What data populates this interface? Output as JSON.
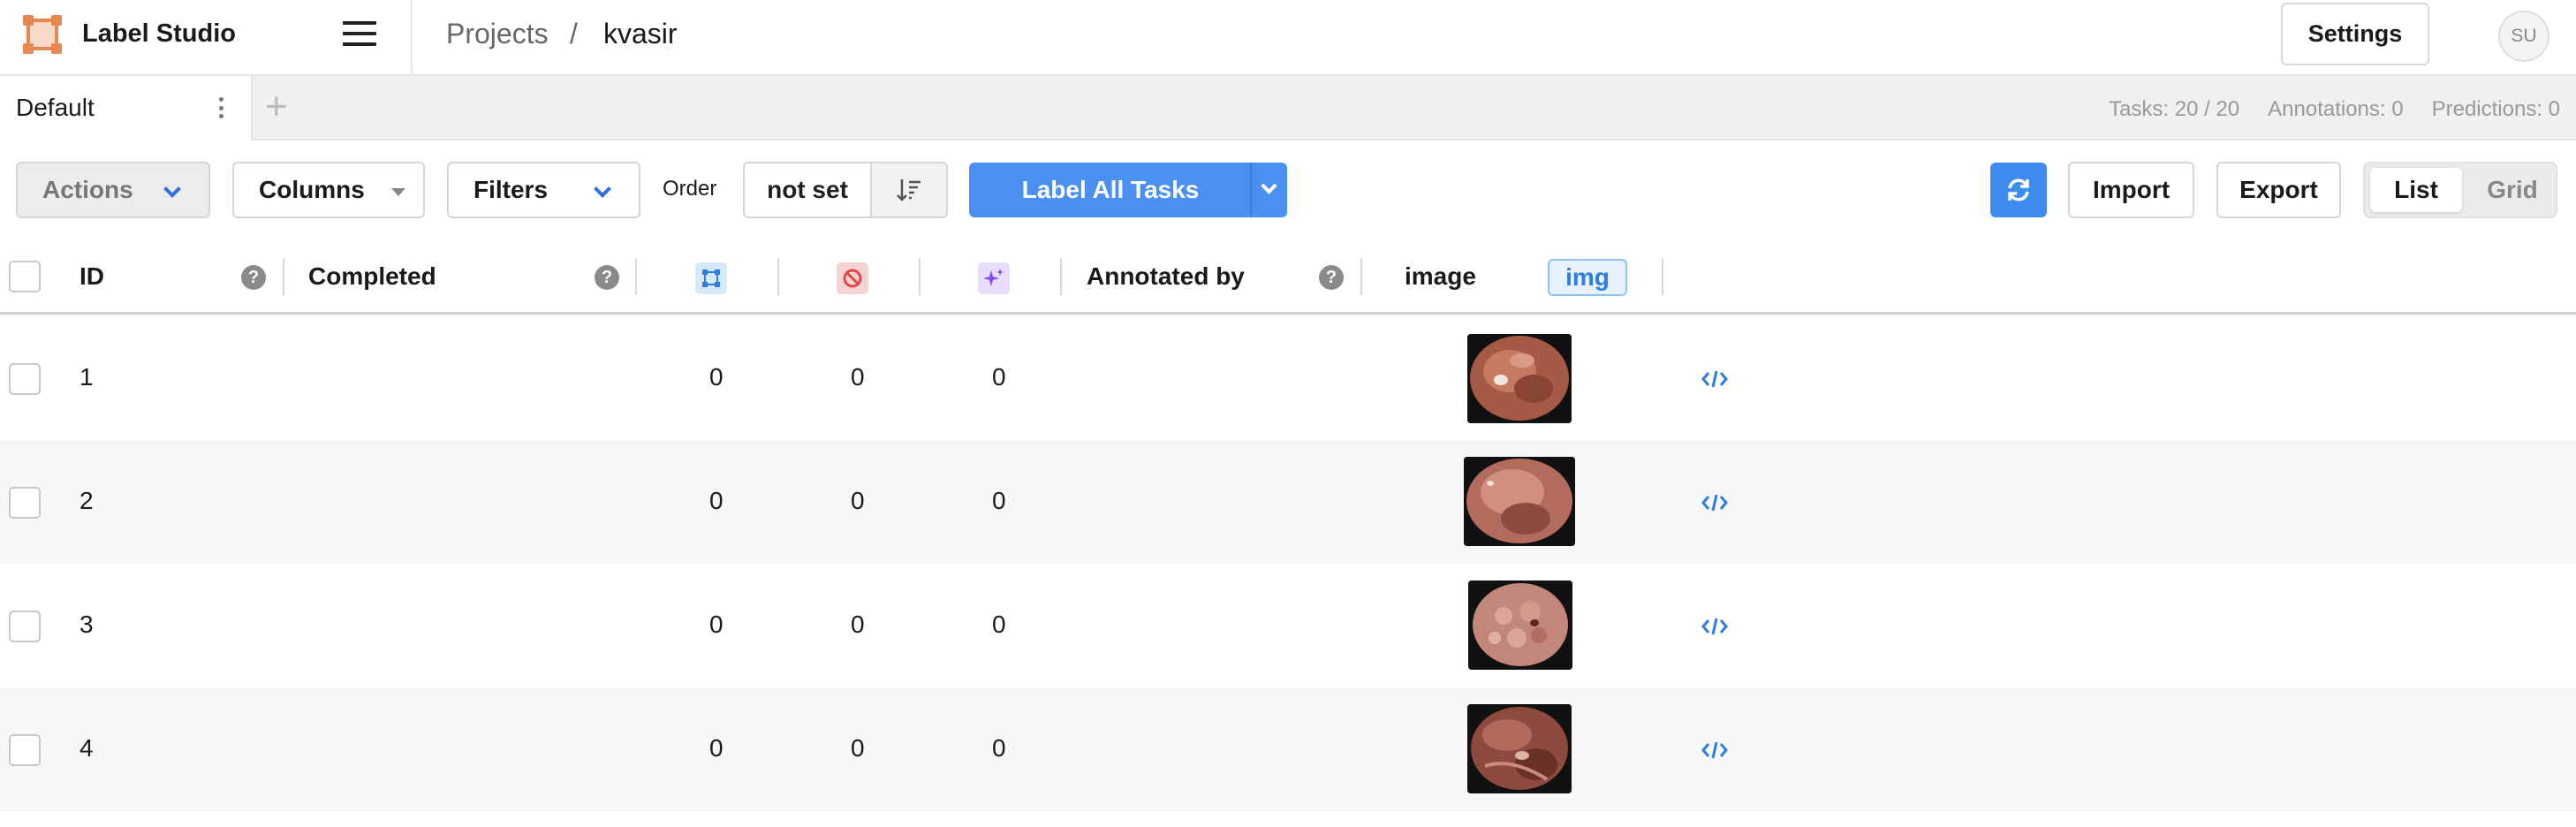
{
  "app": {
    "title": "Label Studio"
  },
  "breadcrumb": {
    "projects": "Projects",
    "separator": "/",
    "current": "kvasir"
  },
  "header": {
    "settings_label": "Settings",
    "avatar_initials": "SU"
  },
  "tabs": [
    {
      "label": "Default",
      "active": true
    }
  ],
  "stats": {
    "tasks": "Tasks: 20 / 20",
    "annotations": "Annotations: 0",
    "predictions": "Predictions: 0"
  },
  "toolbar": {
    "actions": "Actions",
    "columns": "Columns",
    "filters": "Filters",
    "order_label": "Order",
    "order_value": "not set",
    "label_all": "Label All Tasks",
    "import": "Import",
    "export": "Export",
    "view_list": "List",
    "view_grid": "Grid",
    "view_selected": "List"
  },
  "table": {
    "headers": {
      "id": "ID",
      "completed": "Completed",
      "total_annotations_icon": "annotations-icon",
      "cancelled_icon": "cancelled-icon",
      "predictions_icon": "predictions-icon",
      "annotated_by": "Annotated by",
      "image": "image",
      "image_type": "img"
    },
    "rows": [
      {
        "id": "1",
        "completed": "",
        "annotations": "0",
        "cancelled": "0",
        "predictions": "0"
      },
      {
        "id": "2",
        "completed": "",
        "annotations": "0",
        "cancelled": "0",
        "predictions": "0"
      },
      {
        "id": "3",
        "completed": "",
        "annotations": "0",
        "cancelled": "0",
        "predictions": "0"
      },
      {
        "id": "4",
        "completed": "",
        "annotations": "0",
        "cancelled": "0",
        "predictions": "0"
      }
    ]
  },
  "colors": {
    "brand_orange": "#e8874f",
    "primary_blue": "#4a90f0",
    "annotations_icon_bg": "#d7e8fb",
    "cancelled_icon_bg": "#f6d3d3",
    "predictions_icon_bg": "#e8ddfb"
  }
}
